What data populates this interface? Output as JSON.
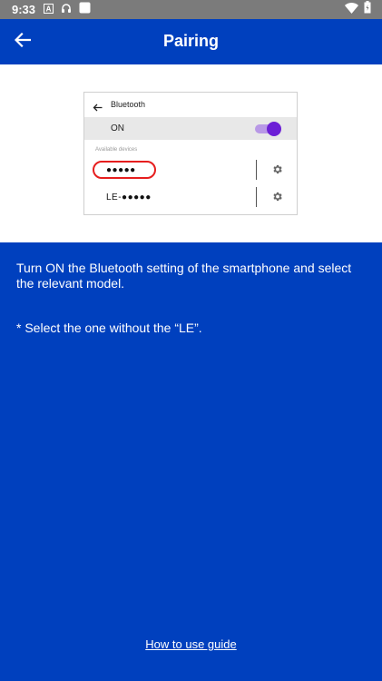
{
  "status_bar": {
    "time": "9:33",
    "left_icons": [
      "text-a-icon",
      "headphones-icon",
      "square-icon"
    ],
    "right_icons": [
      "wifi-icon",
      "battery-icon"
    ]
  },
  "app_bar": {
    "title": "Pairing",
    "back_icon": "arrow-left-icon"
  },
  "illustration": {
    "header_title": "Bluetooth",
    "on_label": "ON",
    "toggle_on": true,
    "available_label": "Available devices",
    "devices": [
      {
        "name": "●●●●●",
        "highlighted": true
      },
      {
        "name": "LE-●●●●●",
        "highlighted": false
      }
    ],
    "highlight_color": "#e61e1e",
    "toggle_color": "#6c1fd6"
  },
  "content": {
    "instruction": "Turn ON the Bluetooth setting of the smartphone and select the relevant model.",
    "note": "* Select the one without the “LE”.",
    "guide_link": "How to use guide"
  },
  "colors": {
    "primary": "#0040be",
    "status_bar": "#7b7b7b",
    "text_on_primary": "#ffffff"
  }
}
